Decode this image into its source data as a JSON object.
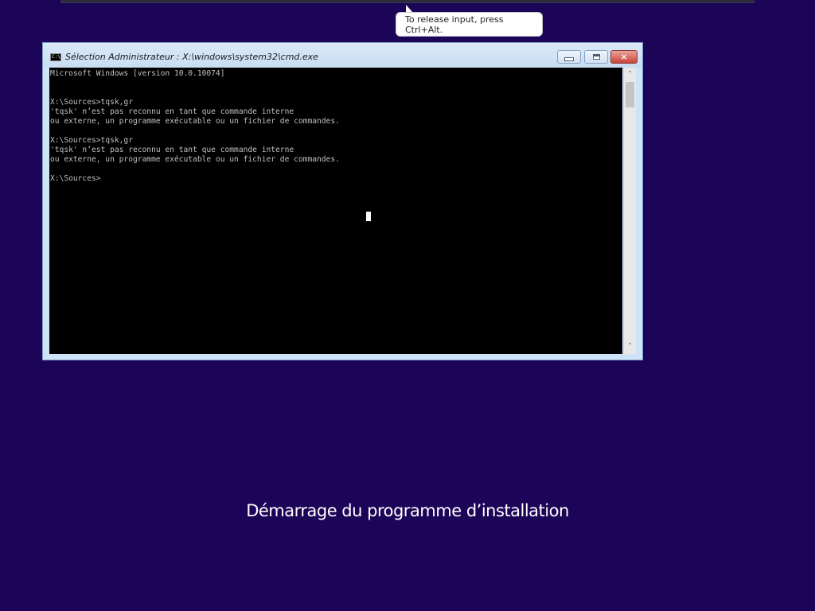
{
  "tooltip": {
    "text": "To release input, press Ctrl+Alt."
  },
  "window": {
    "title": "Sélection Administrateur : X:\\windows\\system32\\cmd.exe",
    "icon_label": "C:\\",
    "buttons": {
      "minimize": "minimize-button",
      "maximize": "maximize-button",
      "close": "×"
    }
  },
  "console": {
    "lines": [
      "Microsoft Windows [version 10.0.10074]",
      "",
      "",
      "X:\\Sources>tqsk,gr",
      "'tqsk' n’est pas reconnu en tant que commande interne",
      "ou externe, un programme exécutable ou un fichier de commandes.",
      "",
      "X:\\Sources>tqsk,gr",
      "'tqsk' n’est pas reconnu en tant que commande interne",
      "ou externe, un programme exécutable ou un fichier de commandes.",
      "",
      "X:\\Sources>"
    ]
  },
  "scrollbar": {
    "up_arrow": "˄",
    "down_arrow": "˅"
  },
  "setup": {
    "status": "Démarrage du programme d’installation"
  },
  "colors": {
    "desktop_bg": "#1c0558",
    "console_bg": "#000000",
    "console_text": "#c0c0c0",
    "close_button": "#c9453a"
  }
}
